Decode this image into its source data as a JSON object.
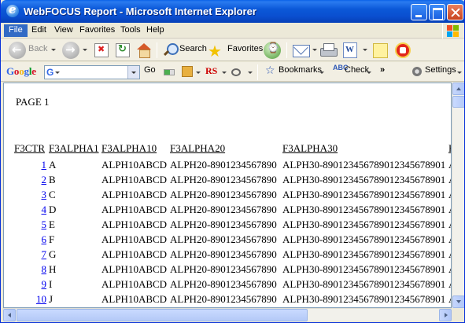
{
  "window": {
    "title": "WebFOCUS Report - Microsoft Internet Explorer"
  },
  "menu": [
    "File",
    "Edit",
    "View",
    "Favorites",
    "Tools",
    "Help"
  ],
  "toolbar": {
    "back_label": "Back",
    "search_label": "Search",
    "favorites_label": "Favorites"
  },
  "google_toolbar": {
    "logo": "Google",
    "search_value": "",
    "go_label": "Go",
    "rs_label": "RS",
    "bookmarks_label": "Bookmarks",
    "check_label": "Check",
    "more_label": "»",
    "settings_label": "Settings"
  },
  "report": {
    "page_label": "PAGE 1",
    "headers": [
      "F3CTR",
      "F3ALPHA1",
      "F3ALPHA10",
      "F3ALPHA20",
      "F3ALPHA30",
      "F"
    ],
    "rows": [
      [
        "1",
        "A",
        "ALPH10ABCD",
        "ALPH20-8901234567890",
        "ALPH30-890123456789012345678901",
        "A"
      ],
      [
        "2",
        "B",
        "ALPH10ABCD",
        "ALPH20-8901234567890",
        "ALPH30-890123456789012345678901",
        "A"
      ],
      [
        "3",
        "C",
        "ALPH10ABCD",
        "ALPH20-8901234567890",
        "ALPH30-890123456789012345678901",
        "A"
      ],
      [
        "4",
        "D",
        "ALPH10ABCD",
        "ALPH20-8901234567890",
        "ALPH30-890123456789012345678901",
        "A"
      ],
      [
        "5",
        "E",
        "ALPH10ABCD",
        "ALPH20-8901234567890",
        "ALPH30-890123456789012345678901",
        "A"
      ],
      [
        "6",
        "F",
        "ALPH10ABCD",
        "ALPH20-8901234567890",
        "ALPH30-890123456789012345678901",
        "A"
      ],
      [
        "7",
        "G",
        "ALPH10ABCD",
        "ALPH20-8901234567890",
        "ALPH30-890123456789012345678901",
        "A"
      ],
      [
        "8",
        "H",
        "ALPH10ABCD",
        "ALPH20-8901234567890",
        "ALPH30-890123456789012345678901",
        "A"
      ],
      [
        "9",
        "I",
        "ALPH10ABCD",
        "ALPH20-8901234567890",
        "ALPH30-890123456789012345678901",
        "A"
      ],
      [
        "10",
        "J",
        "ALPH10ABCD",
        "ALPH20-8901234567890",
        "ALPH30-890123456789012345678901",
        "A"
      ]
    ]
  },
  "icons": {
    "back": "back-arrow-icon",
    "forward": "forward-arrow-icon",
    "stop": "stop-icon",
    "refresh": "refresh-icon",
    "home": "home-icon",
    "search": "search-icon",
    "favorites": "favorites-star-icon",
    "history": "history-icon",
    "mail": "mail-icon",
    "print": "print-icon",
    "edit": "word-edit-icon",
    "discuss": "note-icon",
    "research": "research-icon"
  },
  "colors": {
    "title_bar": "#0a4fd0",
    "link": "#0000ee",
    "menu_active": "#316ac5"
  }
}
